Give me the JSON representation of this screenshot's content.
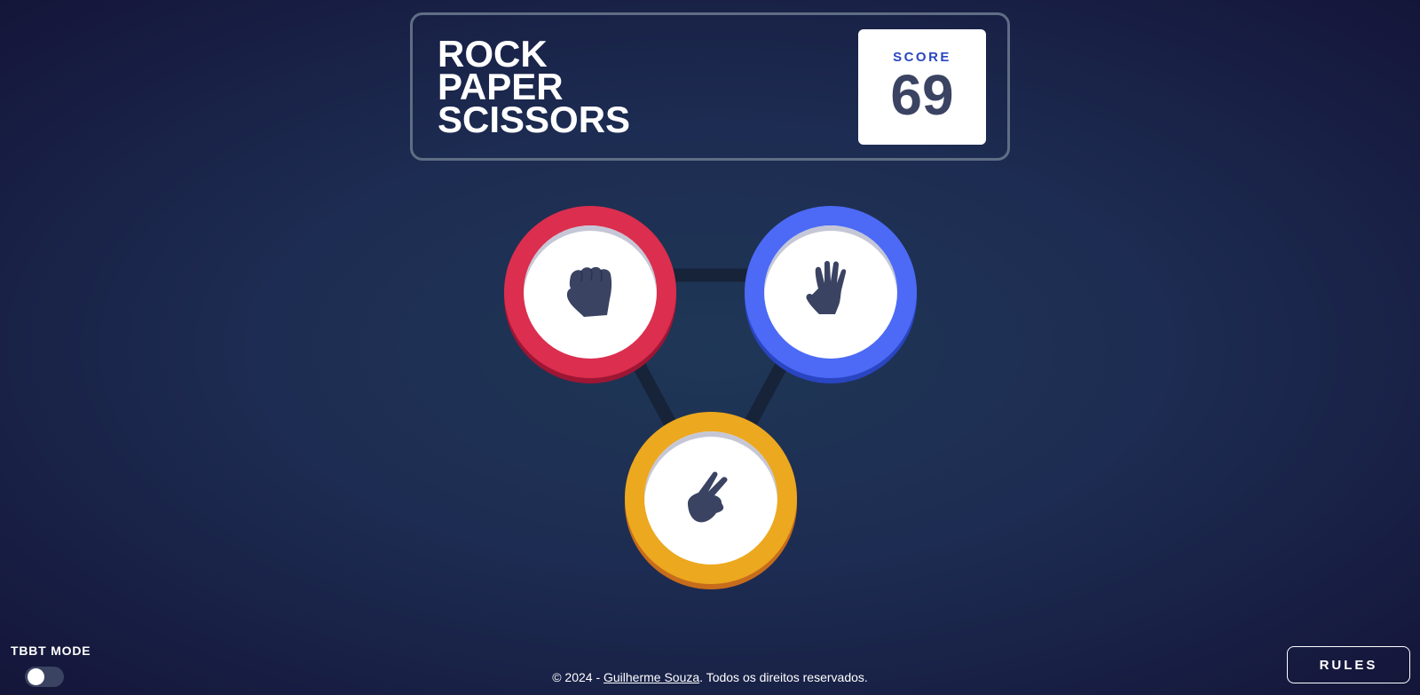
{
  "header": {
    "title_lines": [
      "ROCK",
      "PAPER",
      "SCISSORS"
    ],
    "score_label": "SCORE",
    "score_value": "69"
  },
  "choices": [
    {
      "name": "rock",
      "icon": "fist-icon",
      "color": "#dc2e4e"
    },
    {
      "name": "paper",
      "icon": "open-hand-icon",
      "color": "#4c6af5"
    },
    {
      "name": "scissors",
      "icon": "peace-hand-icon",
      "color": "#eca81e"
    }
  ],
  "mode_toggle": {
    "label": "TBBT MODE",
    "enabled": false
  },
  "footer": {
    "prefix": "© 2024 - ",
    "author": "Guilherme Souza",
    "suffix": ". Todos os direitos reservados."
  },
  "rules_button": {
    "label": "RULES"
  },
  "colors": {
    "background_dark": "#141539",
    "background_light": "#1f3756",
    "header_outline": "#606e85",
    "score_text": "#3b4363",
    "score_label": "#2a46c0"
  }
}
